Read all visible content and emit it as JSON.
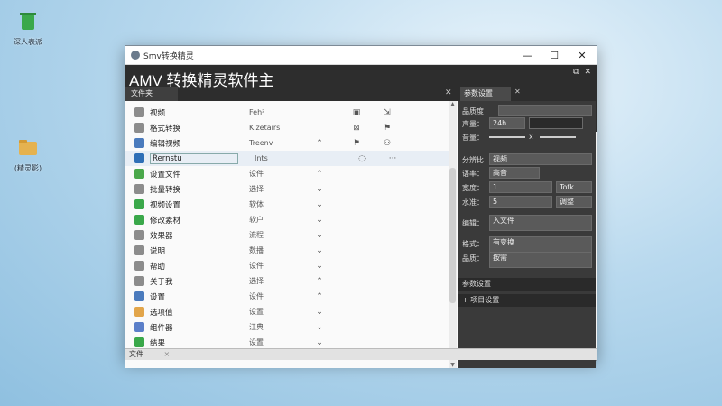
{
  "desktop": {
    "icons": [
      {
        "label": "深人表派"
      },
      {
        "label": "(精灵影)"
      }
    ]
  },
  "window": {
    "titlebar_text": "Smv转换精灵",
    "app_title": "AMV 转换精灵软件主",
    "left_tab": "文件夹",
    "right_tab": "参数设置",
    "status_left": "文件",
    "status_close": "×",
    "controls": {
      "minimize": "—",
      "maximize": "☐",
      "close": "✕"
    }
  },
  "list": {
    "rows": [
      {
        "name": "视频",
        "type": "Feh²",
        "mid": "",
        "extra": "▣",
        "extra2": "⇲",
        "icon": "doc-icon",
        "color": "#8c8c8c"
      },
      {
        "name": "格式转换",
        "type": "Kizetairs",
        "mid": "",
        "extra": "⊠",
        "extra2": "⚑",
        "icon": "pen-icon",
        "color": "#8c8c8c"
      },
      {
        "name": "编辑视频",
        "type": "Treenv",
        "mid": "⌃",
        "extra": "⚑",
        "extra2": "⚇",
        "icon": "doc-icon",
        "color": "#4b7bbd"
      },
      {
        "name": "Rernstu",
        "type": "Ints",
        "mid": "",
        "extra": "◌",
        "extra2": "···",
        "icon": "media-icon",
        "color": "#2f6fb6"
      },
      {
        "name": "设置文件",
        "type": "设件",
        "mid": "⌃",
        "extra": "",
        "extra2": "",
        "icon": "folder-icon",
        "color": "#4aa84a"
      },
      {
        "name": "批量转换",
        "type": "选择",
        "mid": "⌄",
        "extra": "",
        "extra2": "",
        "icon": "doc-icon",
        "color": "#8c8c8c"
      },
      {
        "name": "视频设置",
        "type": "软体",
        "mid": "⌄",
        "extra": "",
        "extra2": "",
        "icon": "circle-icon",
        "color": "#3aa84a"
      },
      {
        "name": "修改素材",
        "type": "软户",
        "mid": "⌄",
        "extra": "",
        "extra2": "",
        "icon": "circle-icon",
        "color": "#3aa84a"
      },
      {
        "name": "效果器",
        "type": "流程",
        "mid": "⌄",
        "extra": "",
        "extra2": "",
        "icon": "doc-icon",
        "color": "#8c8c8c"
      },
      {
        "name": "说明",
        "type": "数播",
        "mid": "⌄",
        "extra": "",
        "extra2": "",
        "icon": "doc-icon",
        "color": "#8c8c8c"
      },
      {
        "name": "帮助",
        "type": "设件",
        "mid": "⌄",
        "extra": "",
        "extra2": "",
        "icon": "doc-icon",
        "color": "#8c8c8c"
      },
      {
        "name": "关于我",
        "type": "选择",
        "mid": "⌃",
        "extra": "",
        "extra2": "",
        "icon": "doc-icon",
        "color": "#8c8c8c"
      },
      {
        "name": "设置",
        "type": "设件",
        "mid": "⌃",
        "extra": "",
        "extra2": "",
        "icon": "doc-icon",
        "color": "#4b7bbd"
      },
      {
        "name": "选项值",
        "type": "设置",
        "mid": "⌄",
        "extra": "",
        "extra2": "",
        "icon": "folder-icon",
        "color": "#e2a54a"
      },
      {
        "name": "组件器",
        "type": "江典",
        "mid": "⌄",
        "extra": "",
        "extra2": "",
        "icon": "circle-icon",
        "color": "#5b7fc9"
      },
      {
        "name": "结果",
        "type": "设置",
        "mid": "⌄",
        "extra": "",
        "extra2": "",
        "icon": "circle-icon",
        "color": "#3aa84a"
      }
    ]
  },
  "props": {
    "r1_label": "品质度",
    "r2_label": "声量：",
    "r2_val": "24h",
    "r3_label": "音量：",
    "r3_x": "x",
    "r4_label": "分辨比",
    "r4_val": "视频",
    "r5_label": "语率：",
    "r5_val": "高音",
    "r6_label": "宽度：",
    "r6_val": "1",
    "r6_unit": "Tofk",
    "r7_label": "水准：",
    "r7_val": "5",
    "r7_unit": "调整",
    "r8_label": "编辑：",
    "r8_val": "入文件",
    "r9_label": "格式：",
    "r9_val": "有变换",
    "r10_label": "品质：",
    "r10_val": "按需",
    "section1": "参数设置",
    "section2": "+ 项目设置"
  }
}
